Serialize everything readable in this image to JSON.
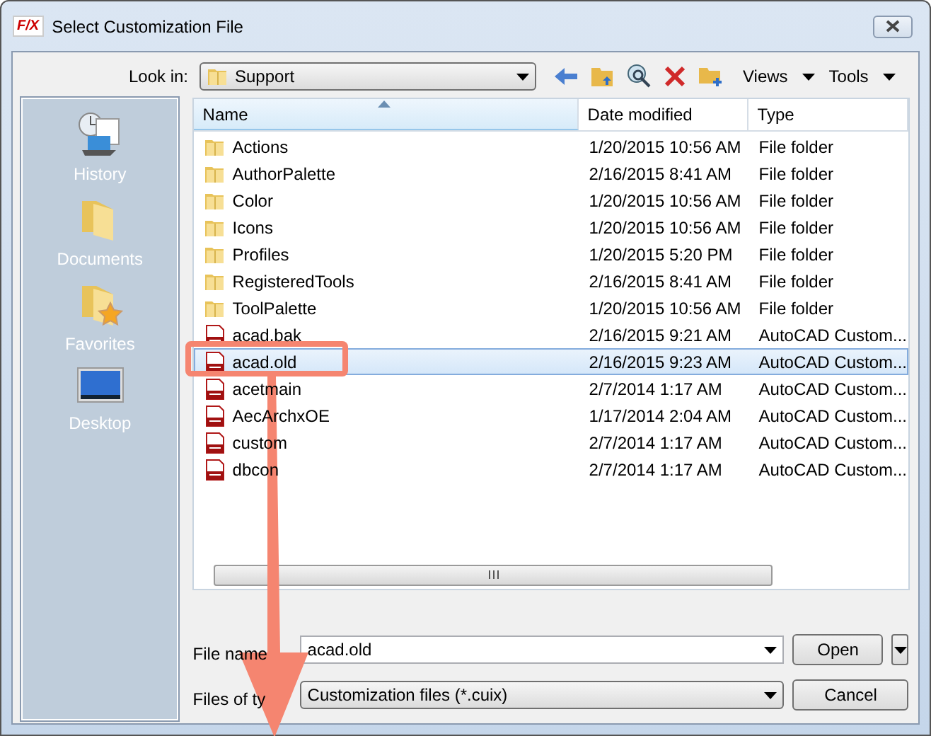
{
  "window": {
    "app_icon": "F/X",
    "title": "Select Customization File"
  },
  "look_in": {
    "label": "Look in:",
    "value": "Support"
  },
  "toolbar": {
    "views": "Views",
    "tools": "Tools"
  },
  "places": [
    {
      "label": "History",
      "kind": "history"
    },
    {
      "label": "Documents",
      "kind": "documents"
    },
    {
      "label": "Favorites",
      "kind": "favorites"
    },
    {
      "label": "Desktop",
      "kind": "desktop"
    }
  ],
  "table": {
    "columns": [
      "Name",
      "Date modified",
      "Type"
    ],
    "rows": [
      {
        "kind": "folder",
        "name": "Actions",
        "date": "1/20/2015 10:56 AM",
        "type": "File folder",
        "selected": false
      },
      {
        "kind": "folder",
        "name": "AuthorPalette",
        "date": "2/16/2015 8:41 AM",
        "type": "File folder",
        "selected": false
      },
      {
        "kind": "folder",
        "name": "Color",
        "date": "1/20/2015 10:56 AM",
        "type": "File folder",
        "selected": false
      },
      {
        "kind": "folder",
        "name": "Icons",
        "date": "1/20/2015 10:56 AM",
        "type": "File folder",
        "selected": false
      },
      {
        "kind": "folder",
        "name": "Profiles",
        "date": "1/20/2015 5:20 PM",
        "type": "File folder",
        "selected": false
      },
      {
        "kind": "folder",
        "name": "RegisteredTools",
        "date": "2/16/2015 8:41 AM",
        "type": "File folder",
        "selected": false
      },
      {
        "kind": "folder",
        "name": "ToolPalette",
        "date": "1/20/2015 10:56 AM",
        "type": "File folder",
        "selected": false
      },
      {
        "kind": "cuix",
        "name": "acad.bak",
        "date": "2/16/2015 9:21 AM",
        "type": "AutoCAD Custom...",
        "selected": false
      },
      {
        "kind": "cuix",
        "name": "acad.old",
        "date": "2/16/2015 9:23 AM",
        "type": "AutoCAD Custom...",
        "selected": true
      },
      {
        "kind": "cuix",
        "name": "acetmain",
        "date": "2/7/2014 1:17 AM",
        "type": "AutoCAD Custom...",
        "selected": false
      },
      {
        "kind": "cuix",
        "name": "AecArchxOE",
        "date": "1/17/2014 2:04 AM",
        "type": "AutoCAD Custom...",
        "selected": false
      },
      {
        "kind": "cuix",
        "name": "custom",
        "date": "2/7/2014 1:17 AM",
        "type": "AutoCAD Custom...",
        "selected": false
      },
      {
        "kind": "cuix",
        "name": "dbcon",
        "date": "2/7/2014 1:17 AM",
        "type": "AutoCAD Custom...",
        "selected": false
      }
    ]
  },
  "file_name": {
    "label": "File name",
    "value": "acad.old"
  },
  "files_of_type": {
    "label": "Files of ty",
    "value": "Customization files (*.cuix)"
  },
  "buttons": {
    "open": "Open",
    "cancel": "Cancel"
  }
}
